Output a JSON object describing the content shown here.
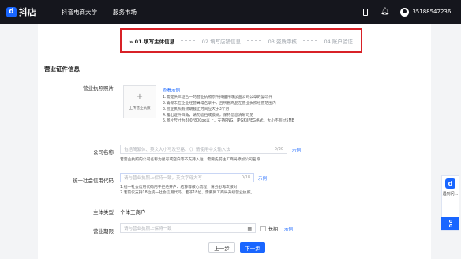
{
  "header": {
    "logo_letter": "d",
    "logo_text": "抖店",
    "nav": [
      "抖音电商大学",
      "服务市场"
    ],
    "user_name": "35188542236..."
  },
  "steps": [
    {
      "label": "» 01.填写主体信息",
      "active": true
    },
    {
      "label": "02.填写店铺信息",
      "active": false
    },
    {
      "label": "03.资质审核",
      "active": false
    },
    {
      "label": "04.账户验证",
      "active": false
    }
  ],
  "section_title": "营业证件信息",
  "license_photo": {
    "label": "营业执照照片",
    "upload_text": "上传营业执照",
    "example": "查看示例",
    "tips": [
      "1.需提供三证合一的营业执照原件扫描件或加盖公司公章的复印件",
      "2.确保未在企业经营异常名录中，且所售商品在营业执照经营范围内",
      "3.营业执照有效期截止时间应大于3个月",
      "4.露出证件四角，请勿遮挡或模糊，保持信息清晰可见",
      "5.图片尺寸为800*800px以上，支持PNG、JPG和JPEG格式，大小不超过5MB"
    ]
  },
  "company_name": {
    "label": "公司名称",
    "placeholder": "包括简繁体、英文大小写及空格、（）请使用中文输入法",
    "count": "0/30",
    "example": "示例",
    "note": "若营业执照的公司名称为星号或空白等不支持入驻，需要先前往工商局添加公司名称"
  },
  "credit_code": {
    "label": "统一社会信用代码",
    "placeholder": "请与营业执照上保持一致，英文字母大写",
    "count": "0/18",
    "example": "示例",
    "notes": [
      "1.统一社会信用代码用于拒绝开户、结算等核心流程，请务必再次核对!",
      "2.若前仅支持18位统一社会信用代码，若非18位，需要到工商局升级营业执照。"
    ]
  },
  "entity_type": {
    "label": "主体类型",
    "value": "个体工商户"
  },
  "business_term": {
    "label": "营业期限",
    "placeholder": "请与营业执照上保持一致",
    "long_label": "长期",
    "example": "示例"
  },
  "buttons": {
    "prev": "上一步",
    "next": "下一步"
  },
  "float_widget": {
    "logo_letter": "d",
    "text": "遇到问..."
  }
}
